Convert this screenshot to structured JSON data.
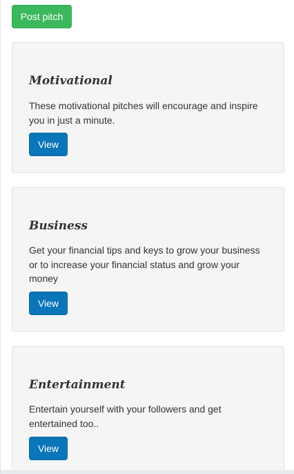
{
  "toolbar": {
    "post_label": "Post pitch"
  },
  "categories": [
    {
      "title": "Motivational",
      "description": "These motivational pitches will encourage and inspire you in just a minute.",
      "button_label": "View"
    },
    {
      "title": "Business",
      "description": "Get your financial tips and keys to grow your business or to increase your financial status and grow your money",
      "button_label": "View"
    },
    {
      "title": "Entertainment",
      "description": "Entertain yourself with your followers and get entertained too..",
      "button_label": "View"
    }
  ],
  "colors": {
    "post_button": "#3cb85c",
    "view_button": "#0a75b9",
    "card_background": "#f5f5f5"
  }
}
